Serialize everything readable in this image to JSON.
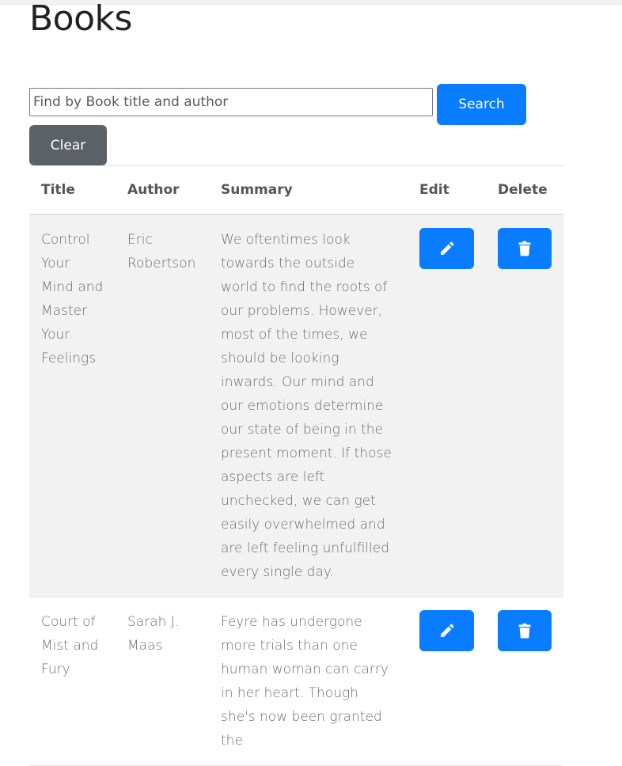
{
  "page": {
    "title": "Books"
  },
  "search": {
    "placeholder": "Find by Book title and author",
    "value": "",
    "search_label": "Search",
    "clear_label": "Clear"
  },
  "table": {
    "headers": {
      "title": "Title",
      "author": "Author",
      "summary": "Summary",
      "edit": "Edit",
      "delete": "Delete"
    },
    "rows": [
      {
        "title": "Control Your Mind and Master Your Feelings",
        "author": "Eric Robertson",
        "summary": "We oftentimes look towards the outside world to find the roots of our problems. However, most of the times, we should be looking inwards. Our mind and our emotions determine our state of being in the present moment. If those aspects are left unchecked, we can get easily overwhelmed and are left feeling unfulfilled every single day.",
        "edit_icon": "pencil-icon",
        "delete_icon": "trash-icon"
      },
      {
        "title": "Court of Mist and Fury",
        "author": "Sarah J. Maas",
        "summary": "Feyre has undergone more trials than one human woman can carry in her heart. Though she's now been granted the",
        "edit_icon": "pencil-icon",
        "delete_icon": "trash-icon"
      }
    ]
  },
  "colors": {
    "primary": "#0a7cff",
    "secondary": "#5b6167",
    "row_stripe": "#f2f2f2"
  }
}
